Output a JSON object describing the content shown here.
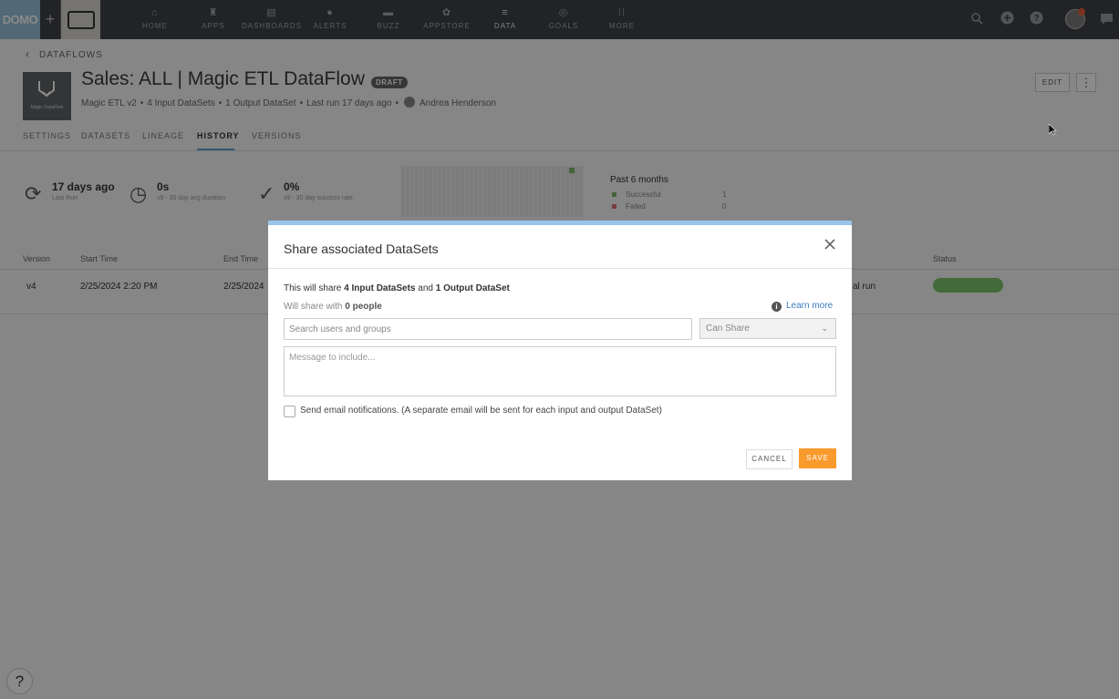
{
  "topnav": {
    "logo": "DOMO",
    "plus": "+",
    "items": [
      {
        "label": "HOME",
        "icon": "home-icon",
        "glyph": "⌂"
      },
      {
        "label": "APPS",
        "icon": "apps-icon",
        "glyph": "♜"
      },
      {
        "label": "DASHBOARDS",
        "icon": "dashboards-icon",
        "glyph": "▤"
      },
      {
        "label": "ALERTS",
        "icon": "alerts-icon",
        "glyph": "●"
      },
      {
        "label": "BUZZ",
        "icon": "buzz-icon",
        "glyph": "▬"
      },
      {
        "label": "APPSTORE",
        "icon": "appstore-icon",
        "glyph": "✿"
      },
      {
        "label": "DATA",
        "icon": "data-icon",
        "glyph": "≡"
      },
      {
        "label": "GOALS",
        "icon": "goals-icon",
        "glyph": "◎"
      },
      {
        "label": "MORE",
        "icon": "more-icon",
        "glyph": "⁞⁞"
      }
    ],
    "active": "DATA"
  },
  "breadcrumb": {
    "label": "DATAFLOWS"
  },
  "dataflow": {
    "icon_label": "Magic DataFlow",
    "title": "Sales: ALL | Magic ETL DataFlow",
    "badge": "DRAFT",
    "meta": {
      "type": "Magic ETL v2",
      "inputs": "4 Input DataSets",
      "outputs": "1 Output DataSet",
      "last_run": "Last run 17 days ago",
      "owner": "Andrea Henderson"
    },
    "edit_label": "EDIT"
  },
  "tabs": [
    {
      "label": "SETTINGS"
    },
    {
      "label": "DATASETS"
    },
    {
      "label": "LINEAGE"
    },
    {
      "label": "HISTORY"
    },
    {
      "label": "VERSIONS"
    }
  ],
  "stats": {
    "last_run": {
      "value": "17 days ago",
      "label": "Last Run"
    },
    "duration": {
      "value": "0s",
      "label": "v9 - 30 day avg duration"
    },
    "success": {
      "value": "0%",
      "label": "v9 - 30 day success rate"
    }
  },
  "summary": {
    "period": "Past 6 months",
    "successful_label": "Successful",
    "successful_value": "1",
    "failed_label": "Failed",
    "failed_value": "0",
    "success_color": "#7cba6a",
    "failed_color": "#e07070"
  },
  "history_table": {
    "headers": {
      "version": "Version",
      "start": "Start Time",
      "end": "End Time",
      "status": "Status"
    },
    "row": {
      "version": "v4",
      "start": "2/25/2024 2:20 PM",
      "end": "2/25/2024",
      "trigger": "al run"
    }
  },
  "modal": {
    "title": "Share associated DataSets",
    "share_prefix": "This will share ",
    "share_inputs": "4 Input DataSets",
    "share_and": " and ",
    "share_outputs": "1 Output DataSet",
    "will_share_prefix": "Will share with ",
    "will_share_count": "0 people",
    "learn_more": "Learn more",
    "search_placeholder": "Search users and groups",
    "permission": "Can Share",
    "message_placeholder": "Message to include...",
    "email_label": "Send email notifications. (A separate email will be sent for each input and output DataSet)",
    "cancel_label": "CANCEL",
    "save_label": "SAVE",
    "accent_color": "#f99a2c"
  },
  "help": {
    "label": "?"
  }
}
